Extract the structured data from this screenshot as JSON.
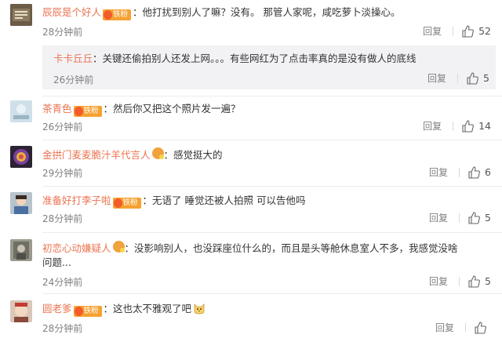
{
  "comments": [
    {
      "user": "辰辰是个好人",
      "badge": "铁粉",
      "text": "：他打扰到别人了嘛？没有。 那管人家呢，咸吃萝卜淡操心。",
      "time": "28分钟前",
      "reply": "回复",
      "likes": "52"
    },
    {
      "user": "茶青色",
      "badge": "铁粉",
      "text": "：然后你又把这个照片发一遍？",
      "time": "26分钟前",
      "reply": "回复",
      "likes": "14"
    },
    {
      "user": "金拱门麦麦脆汁羊代言人",
      "badge": "",
      "text": "：感觉挺大的",
      "time": "29分钟前",
      "reply": "回复",
      "likes": "6"
    },
    {
      "user": "准备好打李子啦",
      "badge": "铁粉",
      "text": "：无语了 睡觉还被人拍照 可以告他吗",
      "time": "28分钟前",
      "reply": "回复",
      "likes": "5"
    },
    {
      "user": "初恋心动嫌疑人",
      "badge": "",
      "text": "：没影响别人，也没踩座位什么的，而且是头等舱休息室人不多，我感觉没啥",
      "text2": "问题...",
      "time": "24分钟前",
      "reply": "回复",
      "likes": "5"
    },
    {
      "user": "圆老爹",
      "badge": "铁粉",
      "text": "：这也太不雅观了吧",
      "time": "28分钟前",
      "reply": "回复",
      "likes": ""
    }
  ],
  "sub_reply": {
    "user": "卡卡丘丘",
    "text": "：关键还偷拍别人还发上网。。。有些网红为了点击率真的是没有做人的底线",
    "time": "26分钟前",
    "reply": "回复",
    "likes": "5"
  },
  "icons": {
    "like": "thumb-up-icon",
    "emoji": "cat-face-emoji-icon"
  }
}
